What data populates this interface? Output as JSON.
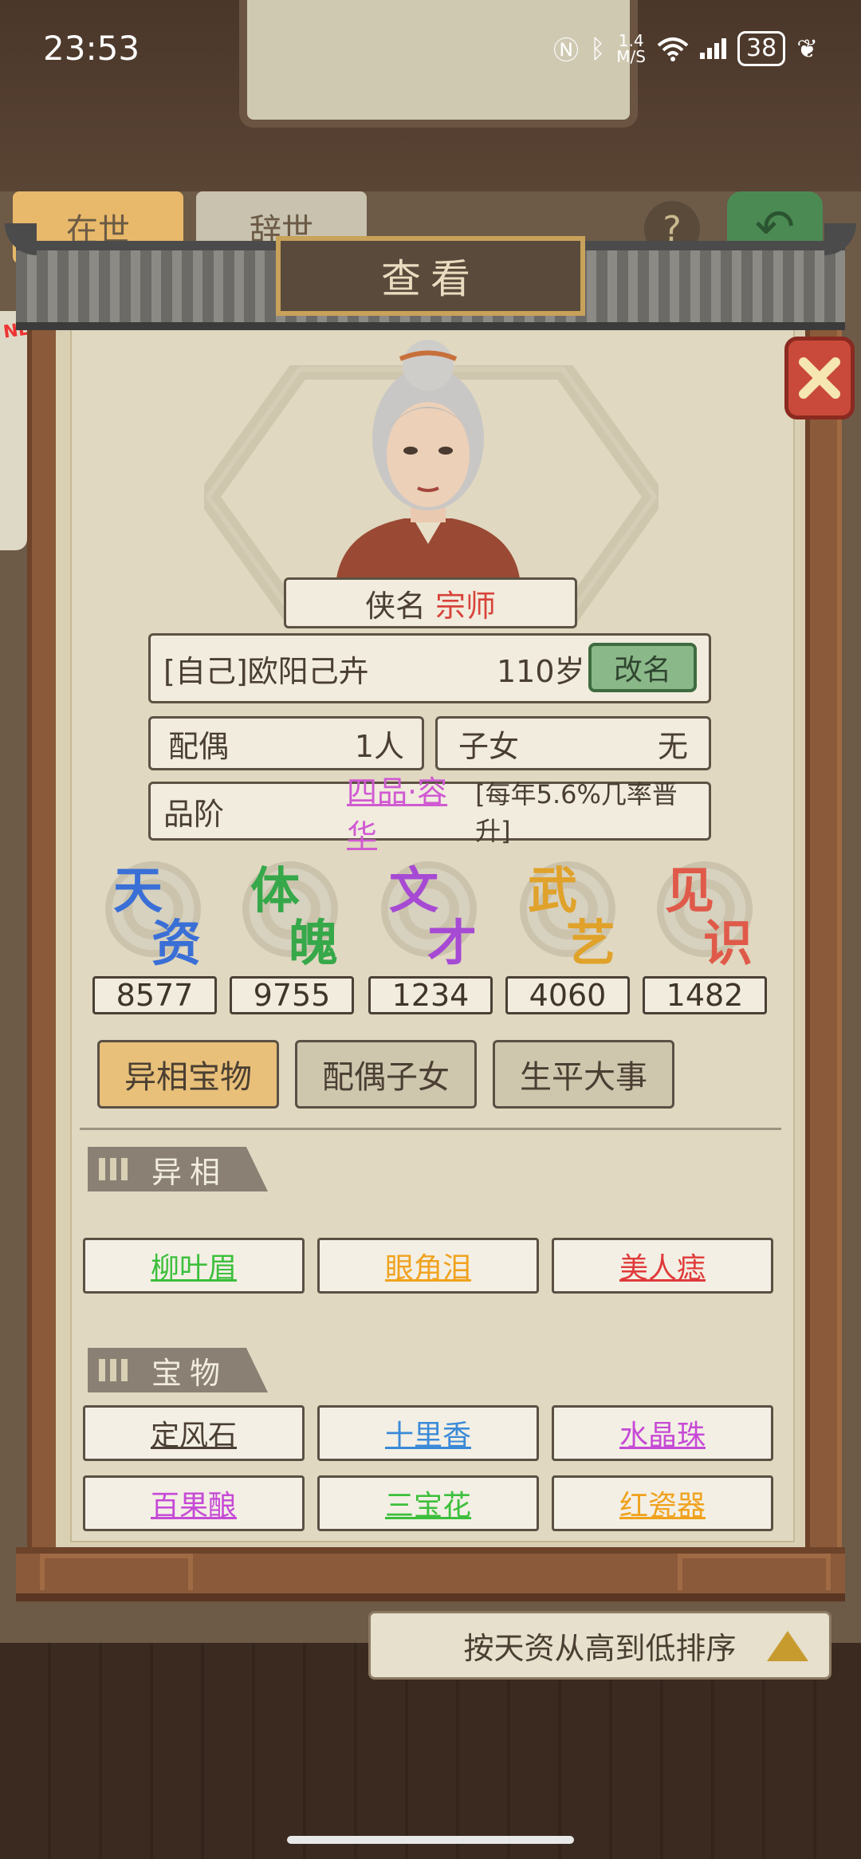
{
  "status_bar": {
    "time": "23:53",
    "net_speed_value": "1.4",
    "net_speed_unit": "M/S",
    "battery": "38"
  },
  "background": {
    "tab_alive": "在世",
    "tab_deceased": "辞世",
    "help_icon": "?",
    "new_badge": "NEW!",
    "sort_label": "按天资从高到低排序"
  },
  "panel": {
    "title": "查看",
    "alias_label": "侠名",
    "alias_value": "宗师",
    "name": "[自己]欧阳己卉",
    "age": "110岁",
    "rename_button": "改名",
    "spouse_label": "配偶",
    "spouse_value": "1人",
    "children_label": "子女",
    "children_value": "无",
    "rank_label": "品阶",
    "rank_value": "四品·容华",
    "rank_note": "[每年5.6%几率晋升]"
  },
  "stats": [
    {
      "c1": "天",
      "c2": "资",
      "value": "8577",
      "color": "#3a6fd6"
    },
    {
      "c1": "体",
      "c2": "魄",
      "value": "9755",
      "color": "#36a84a"
    },
    {
      "c1": "文",
      "c2": "才",
      "value": "1234",
      "color": "#a64ad4"
    },
    {
      "c1": "武",
      "c2": "艺",
      "value": "4060",
      "color": "#e0a22a"
    },
    {
      "c1": "见",
      "c2": "识",
      "value": "1482",
      "color": "#e05a4a"
    }
  ],
  "tabs": [
    "异相宝物",
    "配偶子女",
    "生平大事"
  ],
  "sections": {
    "features": "异相",
    "treasures": "宝物"
  },
  "features": [
    {
      "name": "柳叶眉",
      "color": "#3cbf3c"
    },
    {
      "name": "眼角泪",
      "color": "#f0a21e"
    },
    {
      "name": "美人痣",
      "color": "#e03a3a"
    }
  ],
  "treasures": [
    {
      "name": "定风石",
      "color": "#4a3f32"
    },
    {
      "name": "十里香",
      "color": "#3a8ad8"
    },
    {
      "name": "水晶珠",
      "color": "#c64ad6"
    },
    {
      "name": "百果酿",
      "color": "#c64ad6"
    },
    {
      "name": "三宝花",
      "color": "#3cbf3c"
    },
    {
      "name": "红瓷器",
      "color": "#f0a21e"
    }
  ]
}
